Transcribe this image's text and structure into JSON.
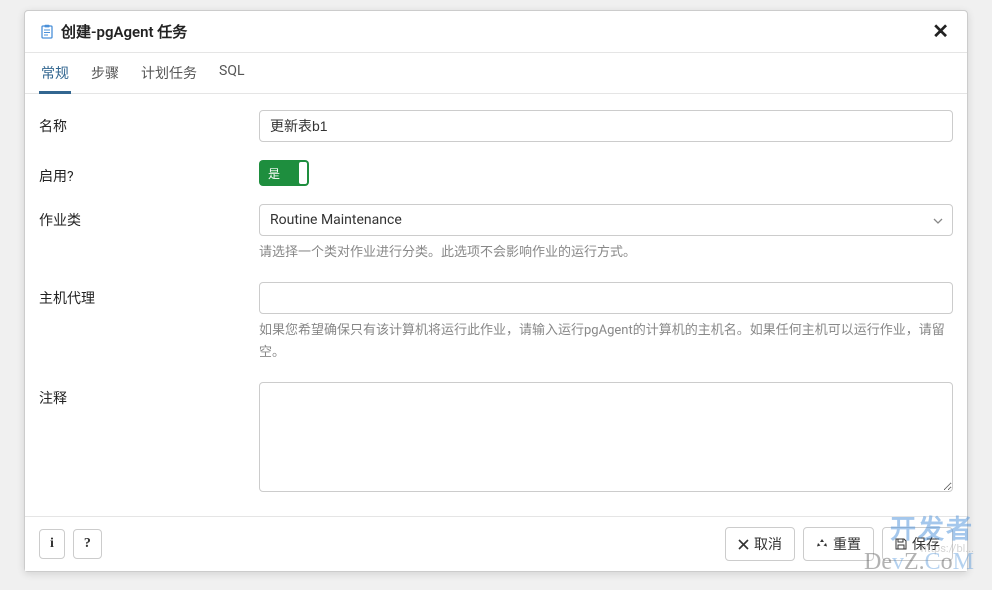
{
  "header": {
    "title": "创建-pgAgent 任务"
  },
  "tabs": [
    {
      "label": "常规",
      "active": true
    },
    {
      "label": "步骤",
      "active": false
    },
    {
      "label": "计划任务",
      "active": false
    },
    {
      "label": "SQL",
      "active": false
    }
  ],
  "form": {
    "name": {
      "label": "名称",
      "value": "更新表b1"
    },
    "enabled": {
      "label": "启用?",
      "toggle_text": "是"
    },
    "job_class": {
      "label": "作业类",
      "value": "Routine Maintenance",
      "help": "请选择一个类对作业进行分类。此选项不会影响作业的运行方式。"
    },
    "host_agent": {
      "label": "主机代理",
      "value": "",
      "help": "如果您希望确保只有该计算机将运行此作业，请输入运行pgAgent的计算机的主机名。如果任何主机可以运行作业，请留空。"
    },
    "comment": {
      "label": "注释",
      "value": ""
    }
  },
  "footer": {
    "info": "i",
    "help": "?",
    "cancel": "取消",
    "reset": "重置",
    "save": "保存"
  },
  "watermark": {
    "line1": "开发者",
    "line2_pre": "De",
    "line2_v": "v",
    "line2_mid1": "Z.",
    "line2_c": "C",
    "line2_mid2": "o",
    "line2_m": "M",
    "url": "https://bl..."
  }
}
